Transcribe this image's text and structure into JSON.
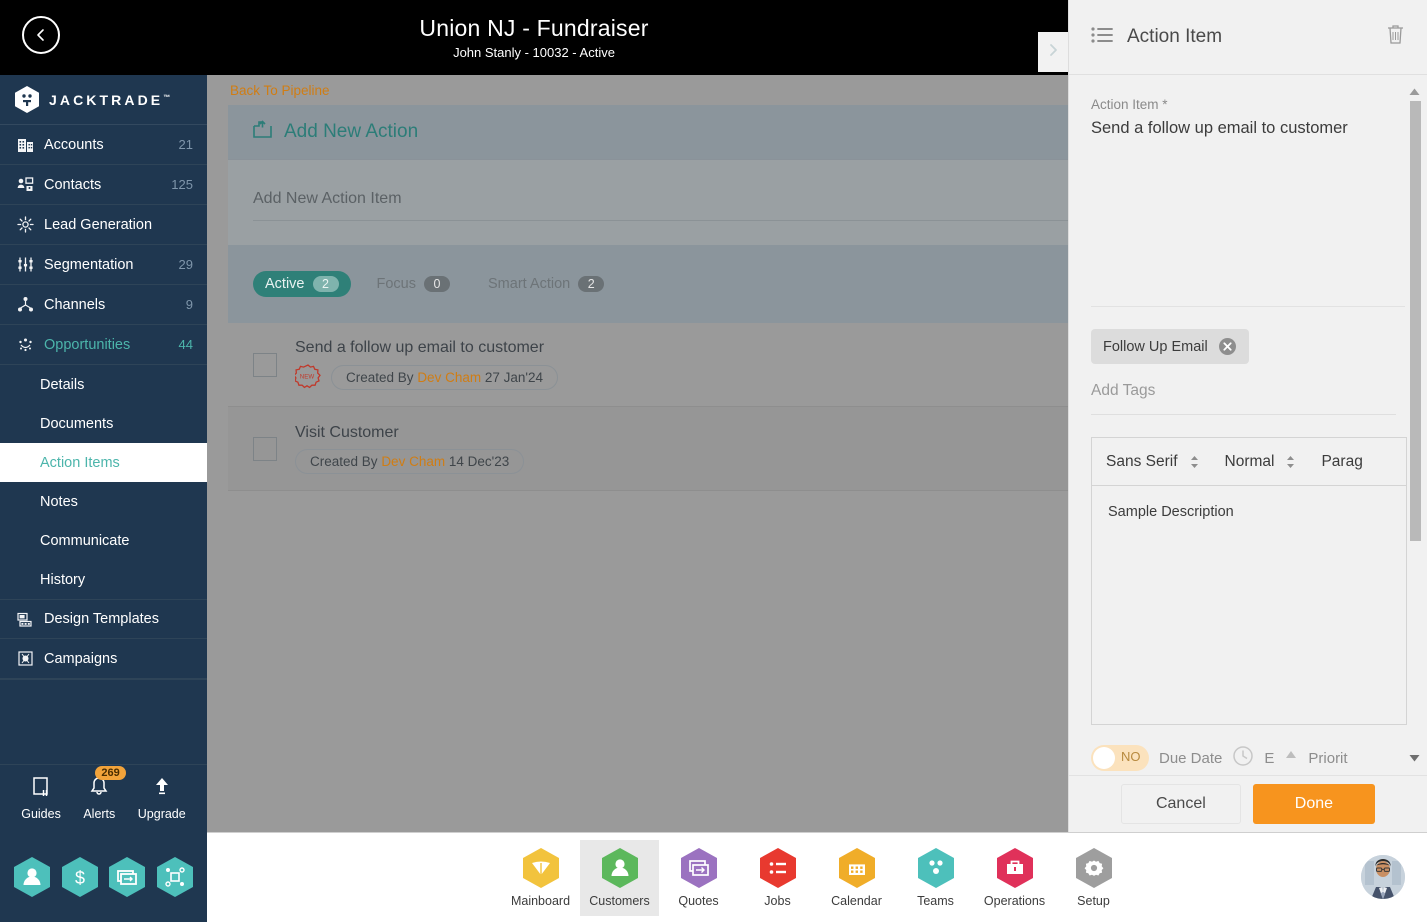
{
  "header": {
    "title": "Union NJ - Fundraiser",
    "subtitle": "John Stanly - 10032 - Active",
    "back_icon": "chevron-left-icon",
    "next_icon": "chevron-right-icon"
  },
  "sidebar": {
    "brand": "JACKTRADE",
    "brand_tm": "™",
    "items": [
      {
        "label": "Accounts",
        "count": "21",
        "icon": "building-icon"
      },
      {
        "label": "Contacts",
        "count": "125",
        "icon": "contacts-icon"
      },
      {
        "label": "Lead Generation",
        "count": "",
        "icon": "lead-generation-icon"
      },
      {
        "label": "Segmentation",
        "count": "29",
        "icon": "segmentation-icon"
      },
      {
        "label": "Channels",
        "count": "9",
        "icon": "channels-icon"
      },
      {
        "label": "Opportunities",
        "count": "44",
        "icon": "opportunities-icon"
      }
    ],
    "sub_items": [
      {
        "label": "Details"
      },
      {
        "label": "Documents"
      },
      {
        "label": "Action Items"
      },
      {
        "label": "Notes"
      },
      {
        "label": "Communicate"
      },
      {
        "label": "History"
      }
    ],
    "items_after": [
      {
        "label": "Design Templates",
        "count": "",
        "icon": "design-templates-icon"
      },
      {
        "label": "Campaigns",
        "count": "",
        "icon": "campaigns-icon"
      }
    ],
    "tools": [
      {
        "label": "Guides",
        "icon": "book-icon",
        "badge": ""
      },
      {
        "label": "Alerts",
        "icon": "bell-icon",
        "badge": "269"
      },
      {
        "label": "Upgrade",
        "icon": "up-arrow-icon",
        "badge": ""
      }
    ],
    "hex_shortcuts": [
      {
        "icon": "person-icon"
      },
      {
        "icon": "dollar-icon"
      },
      {
        "icon": "quote-icon"
      },
      {
        "icon": "workflow-icon"
      }
    ],
    "accent": "#4cb5ab",
    "background": "#1f3750"
  },
  "main": {
    "back_link": "Back To Pipeline",
    "add_new_action": "Add New Action",
    "add_new_action_icon": "add-box-icon",
    "add_item_placeholder": "Add New Action Item",
    "add_item_value": "",
    "tabs": [
      {
        "label": "Active",
        "count": "2",
        "active": true
      },
      {
        "label": "Focus",
        "count": "0",
        "active": false
      },
      {
        "label": "Smart Action",
        "count": "2",
        "active": false
      }
    ],
    "items": [
      {
        "title": "Send a follow up email to customer",
        "badge": "NEW",
        "meta_prefix": "Created By",
        "meta_author": "Dev Cham",
        "meta_date": "27 Jan'24",
        "checked": false
      },
      {
        "title": "Visit Customer",
        "badge": "",
        "meta_prefix": "Created By",
        "meta_author": "Dev Cham",
        "meta_date": "14 Dec'23",
        "checked": false
      }
    ],
    "link_color": "#d07d14",
    "accent": "#2f8078"
  },
  "right_panel": {
    "title": "Action Item",
    "title_icon": "list-icon",
    "delete_icon": "trash-icon",
    "action_item_label": "Action Item *",
    "action_item_value": "Send a follow up email to customer",
    "tags": [
      {
        "label": "Follow Up Email",
        "remove_icon": "close-circle-icon"
      }
    ],
    "tags_placeholder": "Add Tags",
    "tags_value": "",
    "editor": {
      "font_select": "Sans Serif",
      "size_select": "Normal",
      "block_select": "Parag",
      "content": "Sample Description"
    },
    "meta_strip": {
      "toggle_state": "NO",
      "due_date_label": "Due Date",
      "due_date_icon": "clock-icon",
      "estimate_label": "E",
      "priority_icon": "priority-up-icon",
      "priority_label": "Priorit"
    },
    "cancel_label": "Cancel",
    "done_label": "Done",
    "done_color": "#f7941e"
  },
  "bottom_nav": {
    "items": [
      {
        "label": "Mainboard",
        "icon": "mainboard-icon",
        "color": "#f2c33d",
        "selected": false
      },
      {
        "label": "Customers",
        "icon": "customers-icon",
        "color": "#5cb85c",
        "selected": true
      },
      {
        "label": "Quotes",
        "icon": "quotes-icon",
        "color": "#9b72c0",
        "selected": false
      },
      {
        "label": "Jobs",
        "icon": "jobs-icon",
        "color": "#e8392f",
        "selected": false
      },
      {
        "label": "Calendar",
        "icon": "calendar-icon",
        "color": "#f0ad29",
        "selected": false
      },
      {
        "label": "Teams",
        "icon": "teams-icon",
        "color": "#4dc0bb",
        "selected": false
      },
      {
        "label": "Operations",
        "icon": "operations-icon",
        "color": "#e0315a",
        "selected": false
      },
      {
        "label": "Setup",
        "icon": "setup-icon",
        "color": "#9e9e9e",
        "selected": false
      }
    ],
    "avatar_icon": "avatar"
  }
}
